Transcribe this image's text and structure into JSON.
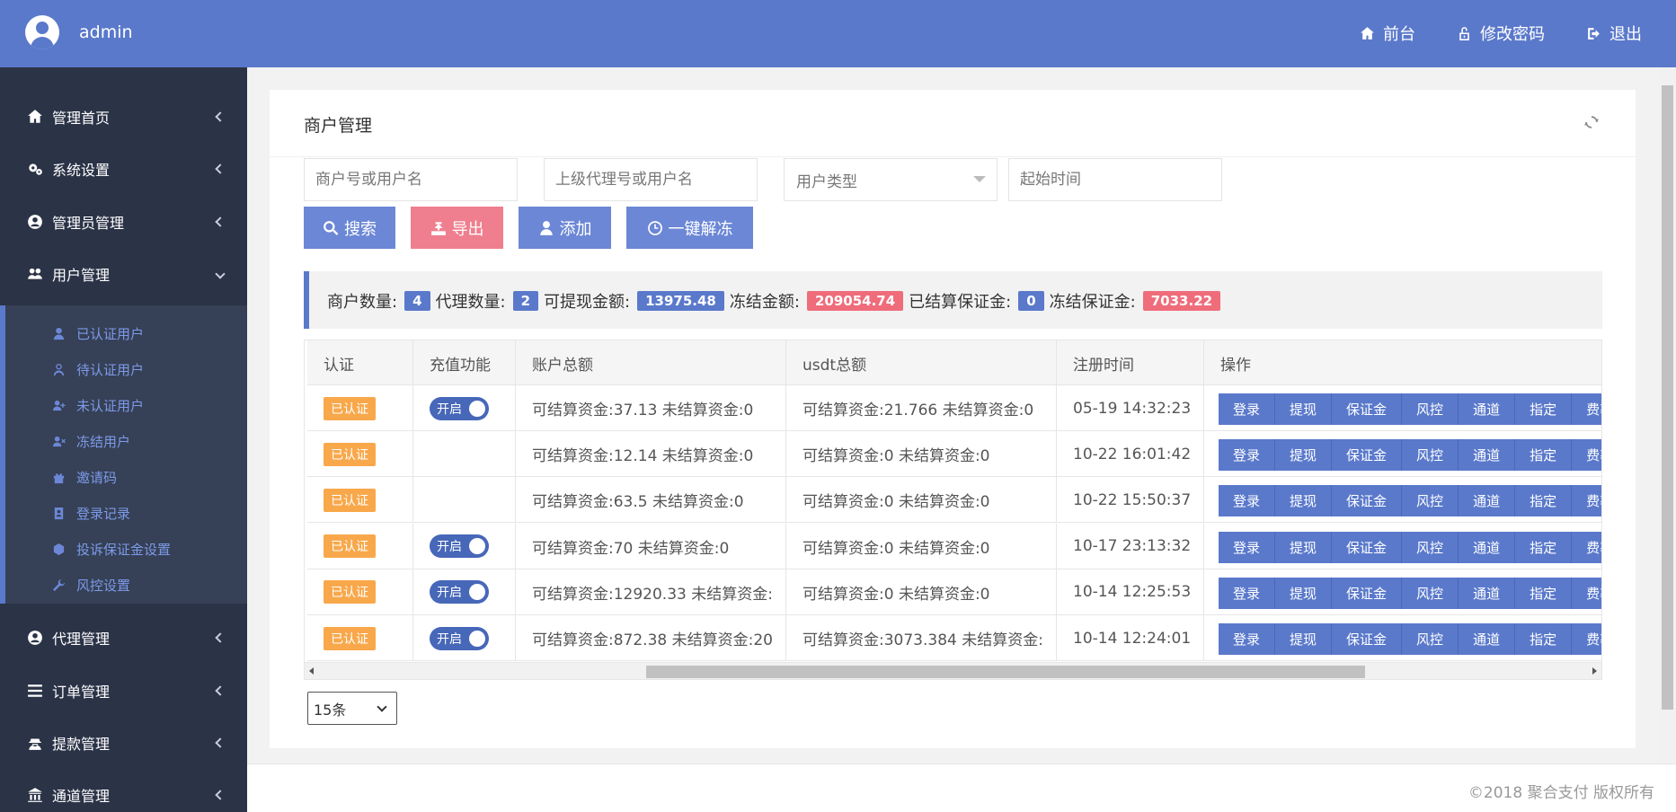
{
  "header": {
    "username": "admin",
    "links": [
      {
        "label": "前台",
        "icon": "home-icon"
      },
      {
        "label": "修改密码",
        "icon": "unlock-icon"
      },
      {
        "label": "退出",
        "icon": "logout-icon"
      }
    ]
  },
  "sidebar": {
    "items": [
      {
        "label": "管理首页",
        "icon": "home-icon"
      },
      {
        "label": "系统设置",
        "icon": "gears-icon"
      },
      {
        "label": "管理员管理",
        "icon": "user-circle-icon"
      },
      {
        "label": "用户管理",
        "icon": "users-icon",
        "expanded": true
      },
      {
        "label": "代理管理",
        "icon": "user-circle-icon"
      },
      {
        "label": "订单管理",
        "icon": "list-icon"
      },
      {
        "label": "提款管理",
        "icon": "user-secret-icon"
      },
      {
        "label": "通道管理",
        "icon": "bank-icon"
      }
    ],
    "submenu": [
      {
        "label": "已认证用户",
        "icon": "user-icon"
      },
      {
        "label": "待认证用户",
        "icon": "user-outline-icon"
      },
      {
        "label": "未认证用户",
        "icon": "user-plus-icon"
      },
      {
        "label": "冻结用户",
        "icon": "user-times-icon"
      },
      {
        "label": "邀请码",
        "icon": "gift-icon"
      },
      {
        "label": "登录记录",
        "icon": "address-book-icon"
      },
      {
        "label": "投诉保证金设置",
        "icon": "gem-icon"
      },
      {
        "label": "风控设置",
        "icon": "wrench-icon"
      }
    ]
  },
  "page": {
    "title": "商户管理"
  },
  "filters": {
    "merchant_placeholder": "商户号或用户名",
    "agent_placeholder": "上级代理号或用户名",
    "user_type": "用户类型",
    "start_time_placeholder": "起始时间"
  },
  "actions": {
    "search": "搜索",
    "export": "导出",
    "add": "添加",
    "unfreeze": "一键解冻"
  },
  "stats": {
    "merchant_count_label": "商户数量:",
    "merchant_count": "4",
    "agent_count_label": "代理数量:",
    "agent_count": "2",
    "withdrawable_label": "可提现金额:",
    "withdrawable": "13975.48",
    "frozen_label": "冻结金额:",
    "frozen": "209054.74",
    "settled_deposit_label": "已结算保证金:",
    "settled_deposit": "0",
    "frozen_deposit_label": "冻结保证金:",
    "frozen_deposit": "7033.22"
  },
  "table": {
    "headers": [
      "认证",
      "充值功能",
      "账户总额",
      "usdt总额",
      "注册时间",
      "操作"
    ],
    "op_buttons": [
      "登录",
      "提现",
      "保证金",
      "风控",
      "通道",
      "指定",
      "费率"
    ],
    "rows": [
      {
        "auth": "已认证",
        "recharge": "开启",
        "account": "可结算资金:37.13 未结算资金:0",
        "usdt": "可结算资金:21.766 未结算资金:0",
        "time": "05-19 14:32:23"
      },
      {
        "auth": "已认证",
        "recharge": "",
        "account": "可结算资金:12.14 未结算资金:0",
        "usdt": "可结算资金:0 未结算资金:0",
        "time": "10-22 16:01:42"
      },
      {
        "auth": "已认证",
        "recharge": "",
        "account": "可结算资金:63.5 未结算资金:0",
        "usdt": "可结算资金:0 未结算资金:0",
        "time": "10-22 15:50:37"
      },
      {
        "auth": "已认证",
        "recharge": "开启",
        "account": "可结算资金:70 未结算资金:0",
        "usdt": "可结算资金:0 未结算资金:0",
        "time": "10-17 23:13:32"
      },
      {
        "auth": "已认证",
        "recharge": "开启",
        "account": "可结算资金:12920.33 未结算资金:",
        "usdt": "可结算资金:0 未结算资金:0",
        "time": "10-14 12:25:53"
      },
      {
        "auth": "已认证",
        "recharge": "开启",
        "account": "可结算资金:872.38 未结算资金:20",
        "usdt": "可结算资金:3073.384 未结算资金:",
        "time": "10-14 12:24:01"
      }
    ]
  },
  "pagination": {
    "page_size": "15条"
  },
  "footer": {
    "copyright": "©2018 聚合支付 版权所有"
  }
}
